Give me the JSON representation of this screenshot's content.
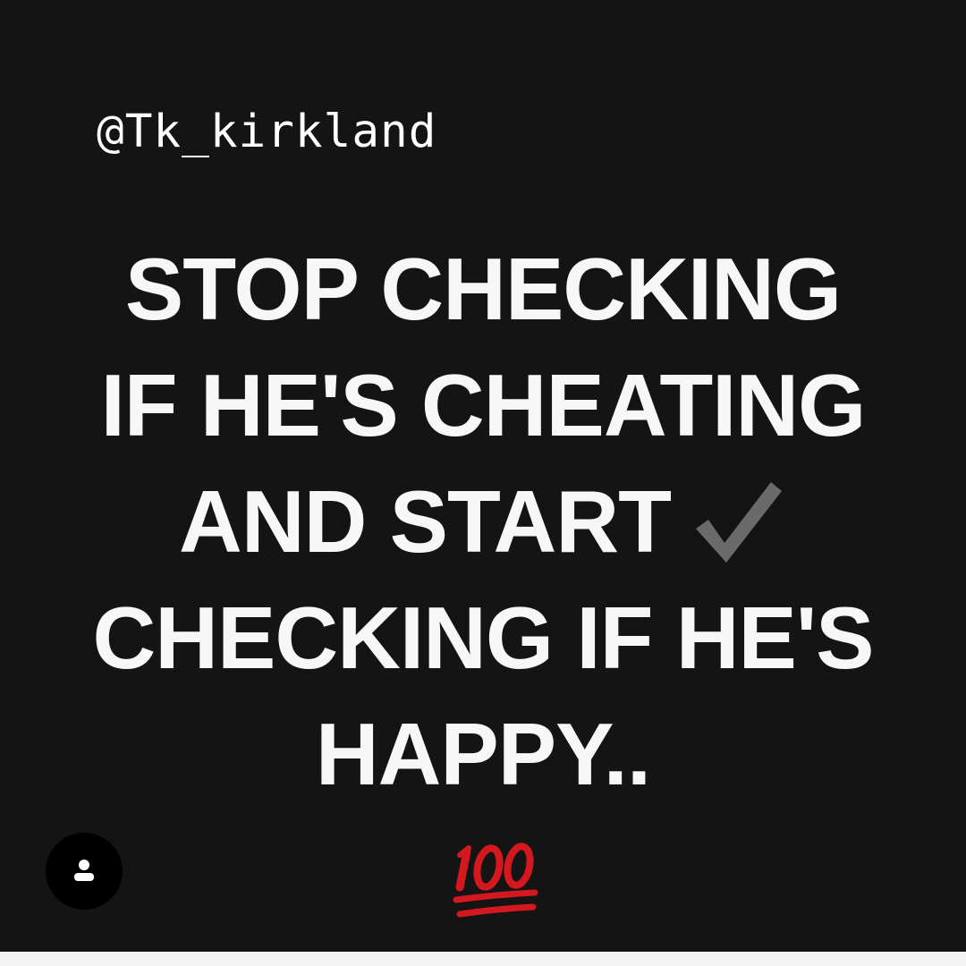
{
  "post": {
    "handle": "@Tk_kirkland",
    "quote_lines": [
      "STOP CHECKING",
      "IF HE'S CHEATING",
      "AND START",
      "CHECKING IF HE'S",
      "HAPPY.."
    ]
  },
  "icons": {
    "checkmark": "heavy-check-mark-icon",
    "hundred": "hundred-points-emoji-icon",
    "profile": "user-silhouette-icon"
  },
  "colors": {
    "background": "#141414",
    "text": "#f7f7f7",
    "checkmark": "#6a6a6a",
    "hundred": "#d4181f",
    "profile_button": "#000000"
  }
}
